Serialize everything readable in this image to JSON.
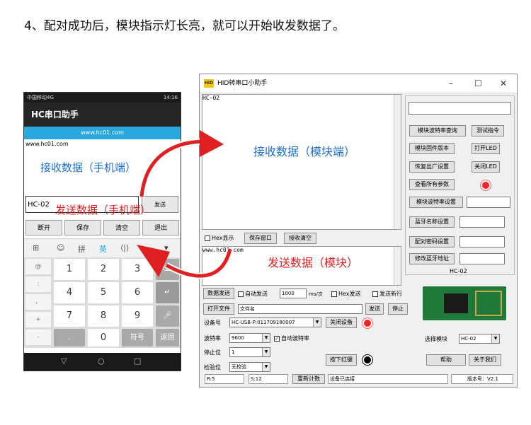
{
  "caption": "4、配对成功后，模块指示灯长亮，就可以开始收发数据了。",
  "annotations": {
    "phone_receive": "接收数据（手机端）",
    "phone_send": "发送数据（手机端）",
    "module_receive": "接收数据（模块端）",
    "module_send": "发送数据（模块）"
  },
  "colors": {
    "accent_blue": "#1f6fd1",
    "accent_red": "#e02020",
    "url_bar": "#29a8e0"
  },
  "phone": {
    "status_left": "中国移动4G",
    "status_right": "14:16",
    "app_title": "HC串口助手",
    "url": "www.hc01.com",
    "received_text": "www.hc01.com",
    "send_input_value": "HC-02",
    "send_button": "发送",
    "buttons": [
      "断开",
      "保存",
      "清空",
      "退出"
    ],
    "keyboard_toolbar": [
      "拼",
      "英"
    ],
    "keys": [
      "1",
      "2",
      "3",
      "4",
      "5",
      "6",
      "7",
      "8",
      "9",
      "0"
    ],
    "side_keys": [
      "@",
      ":",
      "，",
      "+",
      "-"
    ],
    "symbol_key": "符号",
    "return_key": "返回"
  },
  "window": {
    "title": "HID转串口小助手",
    "receive_text": "HC-02",
    "hex_display": "Hex显示",
    "save_window": "保存窗口",
    "clear_receive": "接收清空",
    "send_text": "www.hc01.com",
    "right_panel": {
      "top_input": "",
      "query_baud": "模块波特率查询",
      "test_cmd": "测试指令",
      "firmware": "模块固件版本",
      "open_led": "打开LED",
      "factory_reset": "恢复出厂设置",
      "close_led": "关闭LED",
      "view_params": "查看所有参数",
      "set_baud": "模块波特率设置",
      "set_name": "蓝牙名称设置",
      "set_pin": "配对密码设置",
      "set_addr": "修改蓝牙地址",
      "module_label": "HC-02"
    },
    "data_send": "数据发送",
    "auto_send": "自动发送",
    "interval_value": "1000",
    "interval_unit": "ms/次",
    "hex_send": "Hex发送",
    "send_newline": "发送新行",
    "open_file": "打开文件",
    "file_name": "文件名",
    "send": "发送",
    "stop": "停止",
    "device_label": "设备号",
    "device_value": "HC-USB-P:011709180007",
    "close_device": "关闭设备",
    "baud_label": "波特率",
    "baud_value": "9600",
    "auto_baud": "自动波特率",
    "stopbit_label": "停止位",
    "stopbit_value": "1",
    "parity_label": "检验位",
    "parity_value": "无校验",
    "press_red": "按下红键",
    "select_module": "选择模块",
    "select_module_value": "HC-02",
    "help": "帮助",
    "about": "关于我们",
    "status_r": "R:5",
    "status_s": "S:12",
    "reset_count": "重新计数",
    "device_connected": "设备已连接",
    "version": "版本号：V2.1"
  }
}
